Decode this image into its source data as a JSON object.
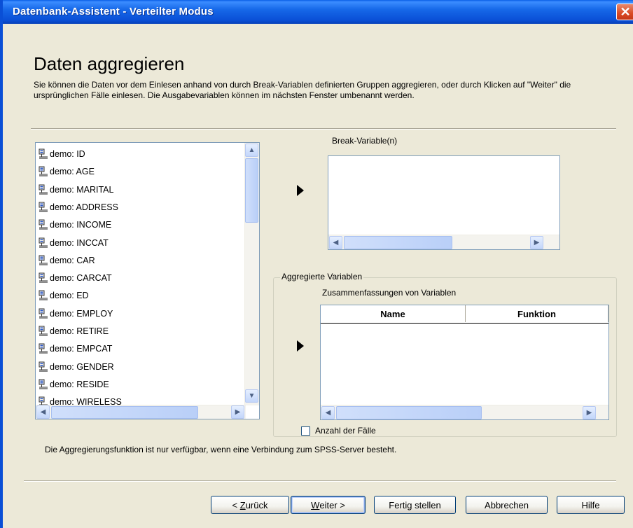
{
  "window": {
    "title": "Datenbank-Assistent - Verteilter Modus",
    "close_glyph": "✕"
  },
  "header": {
    "title": "Daten aggregieren",
    "description": "Sie können die Daten vor dem Einlesen anhand von durch Break-Variablen definierten Gruppen aggregieren, oder durch Klicken auf \"Weiter\" die ursprünglichen Fälle einlesen. Die Ausgabevariablen können im nächsten Fenster umbenannt werden."
  },
  "variables": {
    "items": [
      "demo: ID",
      "demo: AGE",
      "demo: MARITAL",
      "demo: ADDRESS",
      "demo: INCOME",
      "demo: INCCAT",
      "demo: CAR",
      "demo: CARCAT",
      "demo: ED",
      "demo: EMPLOY",
      "demo: RETIRE",
      "demo: EMPCAT",
      "demo: GENDER",
      "demo: RESIDE",
      "demo: WIRELESS"
    ],
    "icon": "variable-icon",
    "scroll_fraction": 0
  },
  "break_variables": {
    "label": "Break-Variable(n)",
    "items": []
  },
  "aggregated": {
    "group_label": "Aggregierte Variablen",
    "summary_label": "Zusammenfassungen von Variablen",
    "columns": [
      "Name",
      "Funktion"
    ],
    "rows": [],
    "count_checkbox_label": "Anzahl der Fälle",
    "count_checked": false
  },
  "note": "Die Aggregierungsfunktion ist nur verfügbar, wenn eine Verbindung zum SPSS-Server besteht.",
  "buttons": {
    "back": {
      "prefix": "< ",
      "mnemonic": "Z",
      "rest": "urück"
    },
    "next": {
      "mnemonic": "W",
      "rest": "eiter >"
    },
    "finish": "Fertig stellen",
    "cancel": "Abbrechen",
    "help": "Hilfe"
  },
  "scroll_glyphs": {
    "up": "▲",
    "down": "▼",
    "left": "◀",
    "right": "▶"
  },
  "colors": {
    "titlebar": "#0a4fd6",
    "dialog_bg": "#ece9d8",
    "list_border": "#7f9db9"
  }
}
